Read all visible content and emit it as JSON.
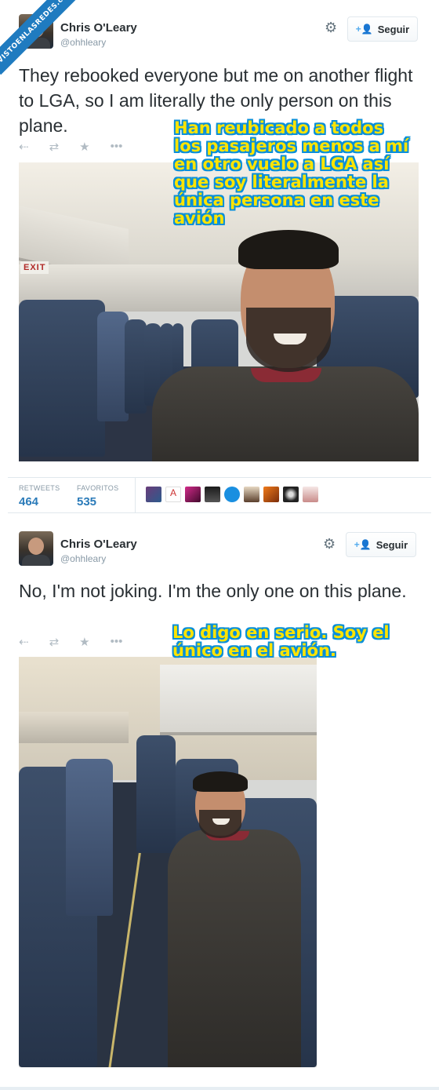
{
  "watermark": "VISTOENLASREDES.com",
  "tweets": [
    {
      "name": "Chris O'Leary",
      "handle": "@ohhleary",
      "follow_label": "Seguir",
      "text": "They rebooked everyone but me on another flight to LGA, so I am literally the only person on this plane.",
      "overlay": "Han reubicado a todos los pasajeros menos a mí en otro vuelo a LGA así que soy literalmente la única persona en este avión",
      "photo_sign": "EXIT",
      "stats": {
        "retweets_label": "RETWEETS",
        "retweets": "464",
        "favorites_label": "FAVORITOS",
        "favorites": "535"
      }
    },
    {
      "name": "Chris O'Leary",
      "handle": "@ohhleary",
      "follow_label": "Seguir",
      "text": "No, I'm not joking. I'm the only one on this plane.",
      "overlay": "Lo digo en serio. Soy el único en el avión."
    }
  ],
  "icons": {
    "gear": "gear-icon",
    "follow": "add-user-icon",
    "reply": "reply-icon",
    "retweet": "retweet-icon",
    "favorite": "star-icon",
    "more": "more-icon"
  },
  "colors": {
    "accent": "#2b7bb9",
    "overlay_text": "#ffe400",
    "overlay_outline": "#0a8fd8",
    "ribbon": "#1f7bc0"
  }
}
